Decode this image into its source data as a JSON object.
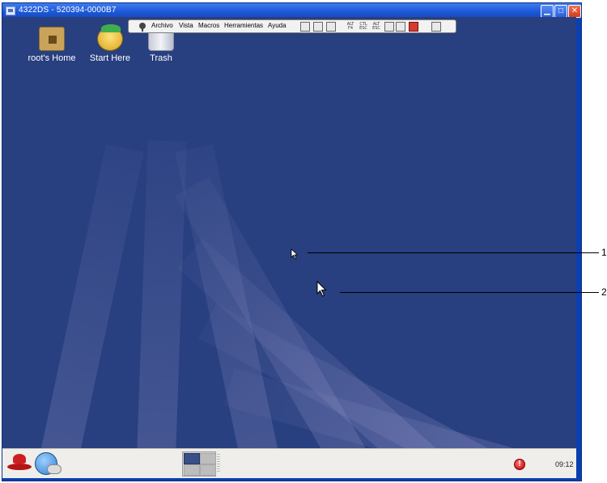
{
  "window": {
    "title": "4322DS - 520394-0000B7",
    "buttons": {
      "minimize": "▁",
      "maximize": "□",
      "close": "✕"
    }
  },
  "desktop": {
    "icons": [
      {
        "label": "root's Home",
        "icon": "home-folder-icon"
      },
      {
        "label": "Start Here",
        "icon": "start-here-icon"
      },
      {
        "label": "Trash",
        "icon": "trash-icon"
      }
    ]
  },
  "toolbar": {
    "menus": [
      "Archivo",
      "Vista",
      "Macros",
      "Herramientas",
      "Ayuda"
    ],
    "key_buttons": [
      "ALT F4",
      "CTL ESC",
      "ALT ESC"
    ]
  },
  "callouts": [
    "1",
    "2"
  ],
  "taskbar": {
    "clock": "09:12",
    "alert_symbol": "!"
  },
  "colors": {
    "desktop": "#283f80",
    "titlebar": "#1b57d6",
    "taskbar": "#efeeea"
  }
}
